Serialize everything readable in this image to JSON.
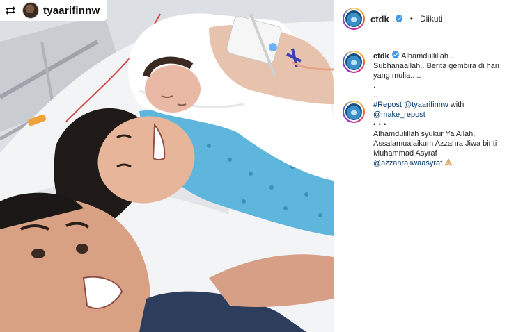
{
  "repost": {
    "username": "tyaarifinnw",
    "icon": "repost-icon"
  },
  "header": {
    "username": "ctdk",
    "separator": "•",
    "follow_status": "Diikuti",
    "verified_icon": "verified-badge-icon"
  },
  "caption": {
    "username": "ctdk",
    "lines": [
      "Alhamdullillah ..",
      "Subhanaallah.. Berita gembira di hari",
      "yang mulia.. .."
    ],
    "dots": [
      ".",
      ".."
    ],
    "repost_tag": "#Repost",
    "repost_user": "@tyaarifinnw",
    "repost_with": "with",
    "make_repost": "@make_repost",
    "bullet_dots": "•   •   •",
    "body_lines": [
      "Alhamdulillah syukur Ya Allah,",
      "Assalamualaikum Azzahra Jiwa binti",
      "Muhammad Asyraf"
    ],
    "mention": "@azzahrajiwaasyraf",
    "emoji_icon": "praying-hands-icon"
  },
  "colors": {
    "link": "#00376b",
    "verified": "#3897f0",
    "gown": "#5fb6dd"
  }
}
